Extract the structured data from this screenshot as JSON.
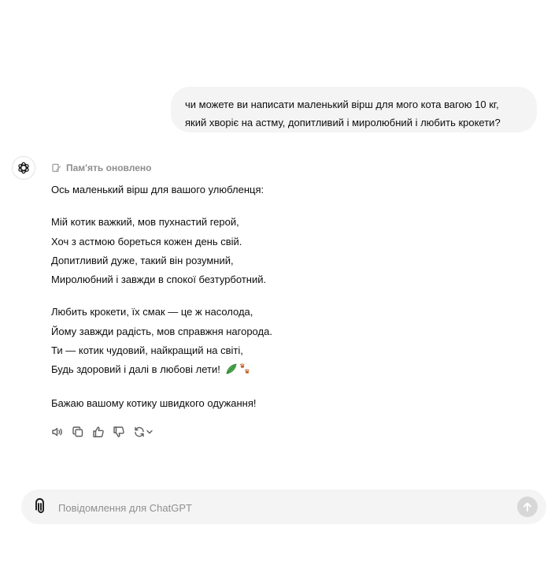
{
  "user_message": {
    "lines": [
      "чи можете ви написати маленький вірш для мого кота вагою 10 кг,",
      "який хворіє на астму, допитливий і миролюбний і любить крокети?"
    ]
  },
  "assistant": {
    "avatar_icon": "openai-logo-icon",
    "memory_icon": "memory-pencil-icon",
    "memory_label": "Пам'ять оновлено",
    "intro": "Ось маленький вірш для вашого улюбленця:",
    "stanza1": [
      "Мій котик важкий, мов пухнастий герой,",
      "Хоч з астмою бореться кожен день свій.",
      "Допитливий дуже, такий він розумний,",
      "Миролюбний і завжди в спокої безтурботний."
    ],
    "stanza2": [
      "Любить крокети, їх смак — це ж насолода,",
      "Йому завжди радість, мов справжня нагорода.",
      "Ти — котик чудовий, найкращий на світі,",
      "Будь здоровий і далі в любові лети!"
    ],
    "emojis": [
      "leaf-emoji",
      "paw-prints-emoji"
    ],
    "closing": "Бажаю вашому котику швидкого одужання!"
  },
  "actions": [
    "read-aloud-icon",
    "copy-icon",
    "thumbs-up-icon",
    "thumbs-down-icon",
    "regenerate-icon",
    "chevron-down-icon"
  ],
  "composer": {
    "placeholder": "Повідомлення для ChatGPT",
    "attach_icon": "paperclip-icon",
    "send_icon": "arrow-up-icon"
  }
}
